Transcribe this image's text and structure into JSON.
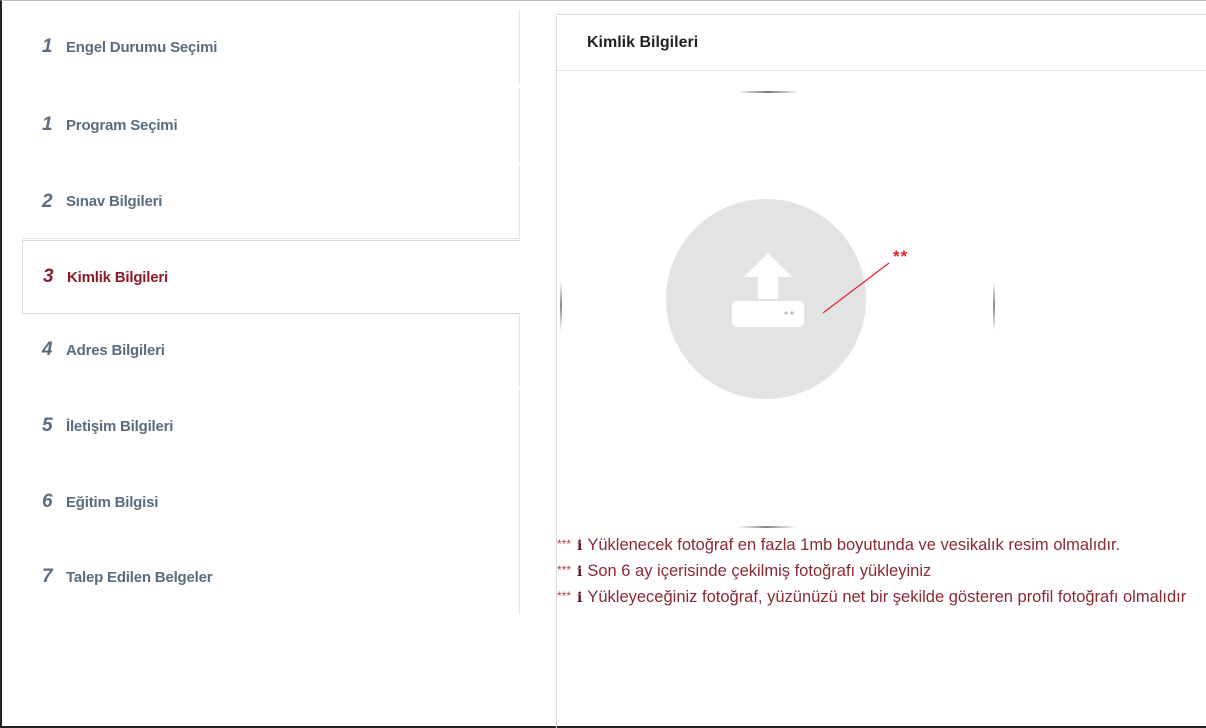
{
  "sidebar": {
    "steps": [
      {
        "num": "1",
        "label": "Engel Durumu Seçimi"
      },
      {
        "num": "1",
        "label": "Program Seçimi"
      },
      {
        "num": "2",
        "label": "Sınav Bilgileri"
      },
      {
        "num": "3",
        "label": "Kimlik Bilgileri"
      },
      {
        "num": "4",
        "label": "Adres Bilgileri"
      },
      {
        "num": "5",
        "label": "İletişim Bilgileri"
      },
      {
        "num": "6",
        "label": "Eğitim Bilgisi"
      },
      {
        "num": "7",
        "label": "Talep Edilen Belgeler"
      }
    ],
    "active_index": 3
  },
  "panel": {
    "title": "Kimlik Bilgileri",
    "upload": {
      "icon": "upload-icon",
      "required_mark": "**"
    },
    "notes": [
      {
        "prefix": "***",
        "icon": "info-icon",
        "text": "Yüklenecek fotoğraf en fazla 1mb boyutunda ve vesikalık resim olmalıdır."
      },
      {
        "prefix": "***",
        "icon": "info-icon",
        "text": "Son 6 ay içerisinde çekilmiş fotoğrafı yükleyiniz"
      },
      {
        "prefix": "***",
        "icon": "info-icon",
        "text": "Yükleyeceğiniz fotoğraf, yüzünüzü net bir şekilde gösteren profil fotoğrafı olmalıdır"
      }
    ]
  },
  "colors": {
    "active_step": "#8a1c2b",
    "step_text": "#5a6d80",
    "note_text": "#8a2a33",
    "required": "#d9262b",
    "upload_circle": "#e3e3e3"
  }
}
